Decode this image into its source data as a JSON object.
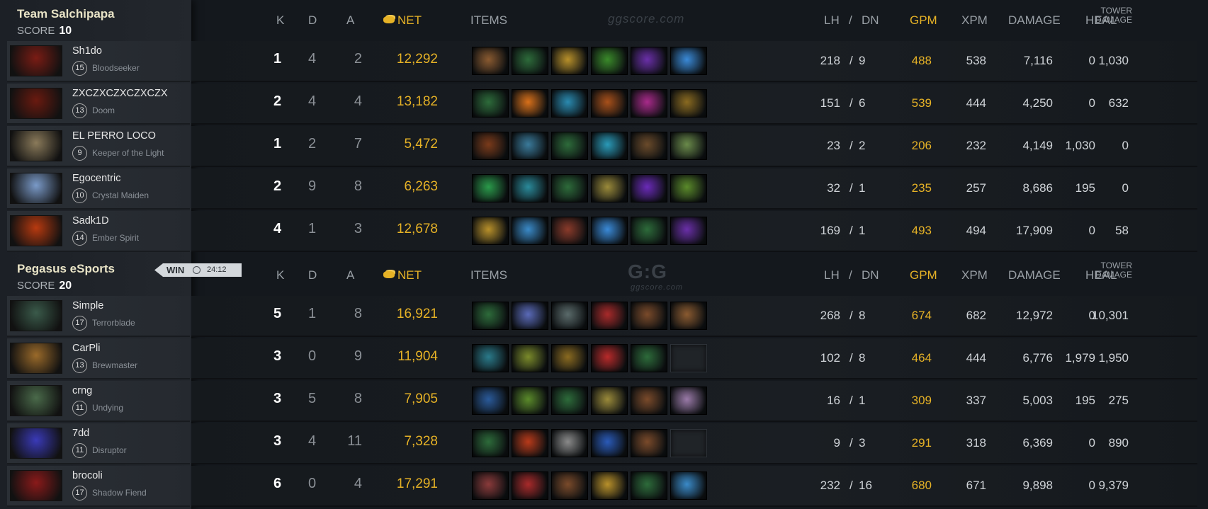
{
  "columns": {
    "k": "K",
    "d": "D",
    "a": "A",
    "net": "NET",
    "items": "ITEMS",
    "lh": "LH",
    "sep": "/",
    "dn": "DN",
    "gpm": "GPM",
    "xpm": "XPM",
    "damage": "DAMAGE",
    "heal": "HEAL",
    "tower1": "TOWER",
    "tower2": "DAMAGE"
  },
  "watermark": {
    "top": "ggscore.com",
    "mid_logo": "G:G",
    "mid_sub": "ggscore.com"
  },
  "result": {
    "label": "WIN",
    "time": "24:12",
    "icon": "clock-icon"
  },
  "teams": [
    {
      "name": "Team Salchipapa",
      "score_label": "SCORE",
      "score": "10",
      "players": [
        {
          "name": "Sh1do",
          "level": "15",
          "hero": "Bloodseeker",
          "k": "1",
          "d": "4",
          "a": "2",
          "net": "12,292",
          "lh": "218",
          "dn": "9",
          "gpm": "488",
          "xpm": "538",
          "damage": "7,116",
          "heal": "0",
          "tower": "1,030",
          "portrait": "#7a1c14",
          "items": [
            "#8a5a30",
            "#2d6b3a",
            "#b8902a",
            "#3a8a2a",
            "#6a2fa8",
            "#3a8ad8"
          ]
        },
        {
          "name": "ZXCZXCZXCZXCZX",
          "level": "13",
          "hero": "Doom",
          "k": "2",
          "d": "4",
          "a": "4",
          "net": "13,182",
          "lh": "151",
          "dn": "6",
          "gpm": "539",
          "xpm": "444",
          "damage": "4,250",
          "heal": "0",
          "tower": "632",
          "portrait": "#6a1a10",
          "items": [
            "#2d6b3a",
            "#d8701a",
            "#2a8ab0",
            "#a8501a",
            "#a82a8a",
            "#8a6a20"
          ]
        },
        {
          "name": "EL PERRO LOCO",
          "level": "9",
          "hero": "Keeper of the Light",
          "k": "1",
          "d": "2",
          "a": "7",
          "net": "5,472",
          "lh": "23",
          "dn": "2",
          "gpm": "206",
          "xpm": "232",
          "damage": "4,149",
          "heal": "1,030",
          "tower": "0",
          "portrait": "#8a7a5a",
          "items": [
            "#7a3a1a",
            "#3a7a9a",
            "#2d6b3a",
            "#2a9ab8",
            "#6a4a2a",
            "#6a8a4a"
          ]
        },
        {
          "name": "Egocentric",
          "level": "10",
          "hero": "Crystal Maiden",
          "k": "2",
          "d": "9",
          "a": "8",
          "net": "6,263",
          "lh": "32",
          "dn": "1",
          "gpm": "235",
          "xpm": "257",
          "damage": "8,686",
          "heal": "195",
          "tower": "0",
          "portrait": "#7a9ac8",
          "items": [
            "#2a9a4a",
            "#2a8a9a",
            "#2d6b3a",
            "#9a8a3a",
            "#6a2ab8",
            "#5a8a2a"
          ]
        },
        {
          "name": "Sadk1D",
          "level": "14",
          "hero": "Ember Spirit",
          "k": "4",
          "d": "1",
          "a": "3",
          "net": "12,678",
          "lh": "169",
          "dn": "1",
          "gpm": "493",
          "xpm": "494",
          "damage": "17,909",
          "heal": "0",
          "tower": "58",
          "portrait": "#b83a10",
          "items": [
            "#b8902a",
            "#3a8ac8",
            "#8a3a2a",
            "#3a8ad8",
            "#2d6b3a",
            "#6a2fa8"
          ]
        }
      ]
    },
    {
      "name": "Pegasus eSports",
      "score_label": "SCORE",
      "score": "20",
      "players": [
        {
          "name": "Simple",
          "level": "17",
          "hero": "Terrorblade",
          "k": "5",
          "d": "1",
          "a": "8",
          "net": "16,921",
          "lh": "268",
          "dn": "8",
          "gpm": "674",
          "xpm": "682",
          "damage": "12,972",
          "heal": "0",
          "tower": "10,301",
          "portrait": "#3a5a4a",
          "items": [
            "#2d6b3a",
            "#5a6ab8",
            "#5a6a6a",
            "#a82a2a",
            "#7a4a2a",
            "#8a5a30"
          ]
        },
        {
          "name": "CarPli",
          "level": "13",
          "hero": "Brewmaster",
          "k": "3",
          "d": "0",
          "a": "9",
          "net": "11,904",
          "lh": "102",
          "dn": "8",
          "gpm": "464",
          "xpm": "444",
          "damage": "6,776",
          "heal": "1,979",
          "tower": "1,950",
          "portrait": "#9a6a2a",
          "items": [
            "#2a7a8a",
            "#7a8a2a",
            "#8a6a20",
            "#b82a2a",
            "#2d6b3a",
            ""
          ]
        },
        {
          "name": "crng",
          "level": "11",
          "hero": "Undying",
          "k": "3",
          "d": "5",
          "a": "8",
          "net": "7,905",
          "lh": "16",
          "dn": "1",
          "gpm": "309",
          "xpm": "337",
          "damage": "5,003",
          "heal": "195",
          "tower": "275",
          "portrait": "#4a6a4a",
          "items": [
            "#2a5a9a",
            "#5a8a2a",
            "#2d6b3a",
            "#9a8a3a",
            "#7a4a2a",
            "#9a7aa8"
          ]
        },
        {
          "name": "7dd",
          "level": "11",
          "hero": "Disruptor",
          "k": "3",
          "d": "4",
          "a": "11",
          "net": "7,328",
          "lh": "9",
          "dn": "3",
          "gpm": "291",
          "xpm": "318",
          "damage": "6,369",
          "heal": "0",
          "tower": "890",
          "portrait": "#3a3ab8",
          "items": [
            "#2d6b3a",
            "#b83a1a",
            "#8a8a8a",
            "#2a5ab8",
            "#7a4a2a",
            ""
          ]
        },
        {
          "name": "brocoli",
          "level": "17",
          "hero": "Shadow Fiend",
          "k": "6",
          "d": "0",
          "a": "4",
          "net": "17,291",
          "lh": "232",
          "dn": "16",
          "gpm": "680",
          "xpm": "671",
          "damage": "9,898",
          "heal": "0",
          "tower": "9,379",
          "portrait": "#8a1a1a",
          "items": [
            "#8a3a3a",
            "#a82a2a",
            "#7a4a2a",
            "#b8902a",
            "#2d6b3a",
            "#3a8ac8"
          ]
        }
      ]
    }
  ]
}
